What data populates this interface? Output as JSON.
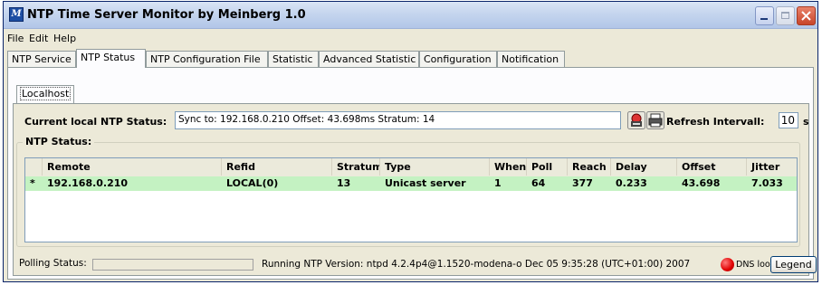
{
  "window": {
    "title": "NTP Time Server Monitor by Meinberg 1.0",
    "app_icon_glyph": "M"
  },
  "menu": [
    "File",
    "Edit",
    "Help"
  ],
  "tabs": [
    "NTP Service",
    "NTP Status",
    "NTP Configuration File",
    "Statistic",
    "Advanced Statistic",
    "Configuration",
    "Notification"
  ],
  "active_tab": "NTP Status",
  "subtab": "Localhost",
  "status": {
    "label": "Current local NTP Status:",
    "value": "Sync to: 192.168.0.210   Offset: 43.698ms   Stratum: 14"
  },
  "refresh": {
    "label": "Refresh Intervall:",
    "value": "10",
    "unit": "s"
  },
  "group_title": "NTP Status:",
  "table": {
    "columns": [
      "",
      "Remote",
      "Refid",
      "Stratum",
      "Type",
      "When",
      "Poll",
      "Reach",
      "Delay",
      "Offset",
      "Jitter"
    ],
    "rows": [
      {
        "marker": "*",
        "remote": "192.168.0.210",
        "refid": "LOCAL(0)",
        "stratum": "13",
        "type": "Unicast server",
        "when": "1",
        "poll": "64",
        "reach": "377",
        "delay": "0.233",
        "offset": "43.698",
        "jitter": "7.033"
      }
    ],
    "row_highlight_color": "#c4f2c2"
  },
  "statusbar": {
    "polling_label": "Polling Status:",
    "version": "Running NTP Version: ntpd 4.2.4p4@1.1520-modena-o Dec 05 9:35:28 (UTC+01:00) 2007",
    "dns_label": "DNS lookup",
    "dns_status_color": "#e00000",
    "legend_button": "Legend"
  },
  "icons": [
    "app-icon",
    "minimize-icon",
    "maximize-icon",
    "close-icon",
    "network-icon",
    "printer-icon",
    "status-indicator-icon"
  ]
}
